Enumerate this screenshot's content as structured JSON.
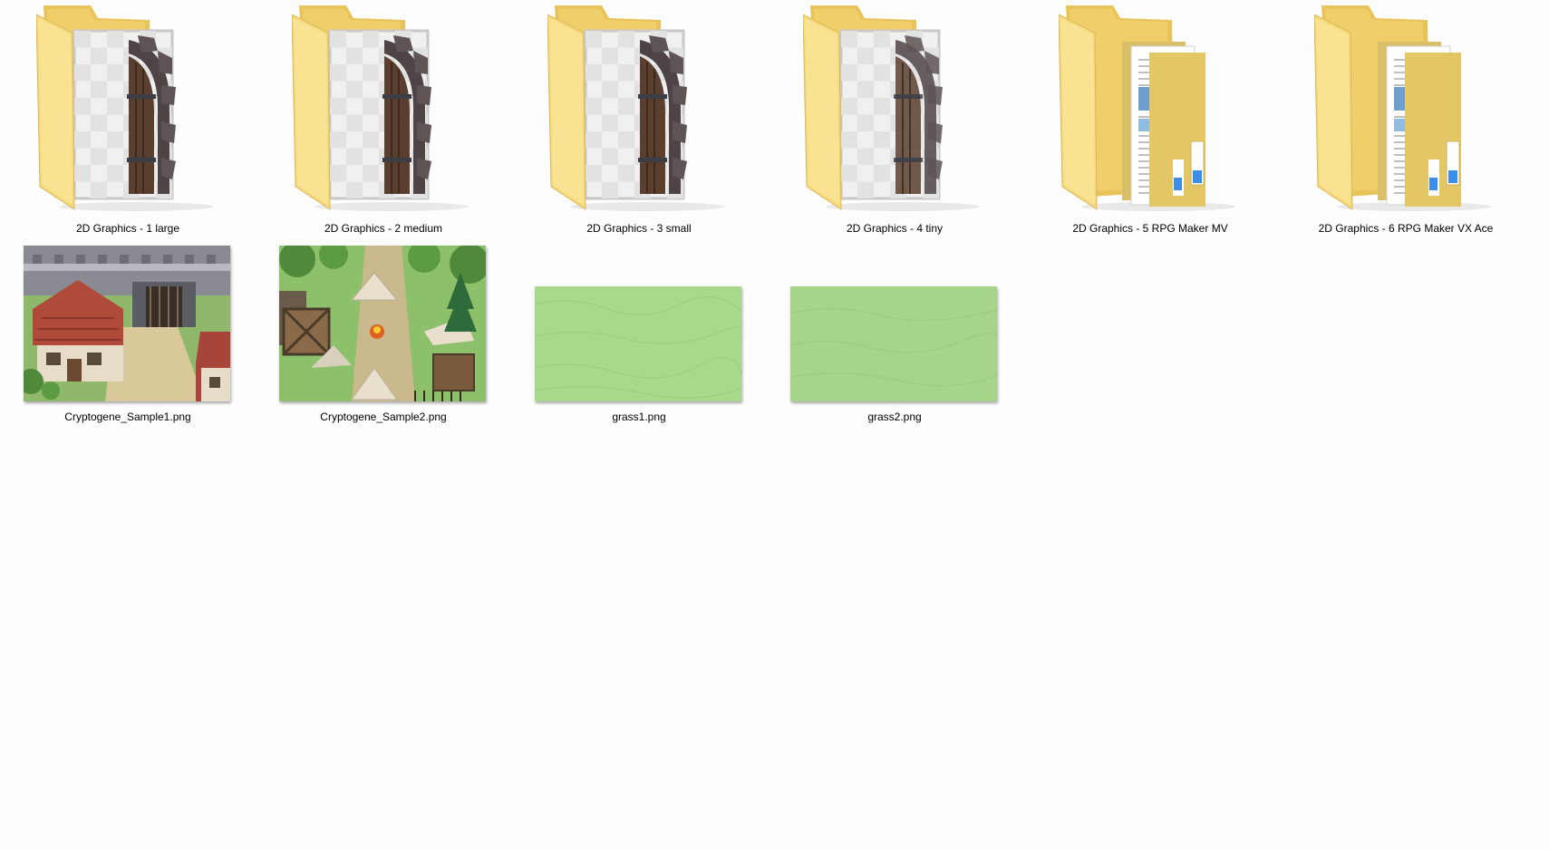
{
  "folders": [
    {
      "name": "2D Graphics - 1 large",
      "content": "door"
    },
    {
      "name": "2D Graphics - 2 medium",
      "content": "door"
    },
    {
      "name": "2D Graphics - 3 small",
      "content": "door"
    },
    {
      "name": "2D Graphics - 4 tiny",
      "content": "door"
    },
    {
      "name": "2D Graphics - 5 RPG Maker MV",
      "content": "documents"
    },
    {
      "name": "2D Graphics - 6 RPG Maker VX Ace",
      "content": "documents"
    }
  ],
  "files": [
    {
      "name": "Cryptogene_Sample1.png",
      "kind": "village"
    },
    {
      "name": "Cryptogene_Sample2.png",
      "kind": "camp"
    },
    {
      "name": "grass1.png",
      "kind": "grass"
    },
    {
      "name": "grass2.png",
      "kind": "grass"
    }
  ],
  "icons": {
    "folder": "folder-icon",
    "image": "image-thumbnail"
  },
  "colors": {
    "folder_front": "#f5d97a",
    "folder_back": "#e8c35a",
    "grass": "#a8d88a",
    "background": "#fdfdfd"
  }
}
